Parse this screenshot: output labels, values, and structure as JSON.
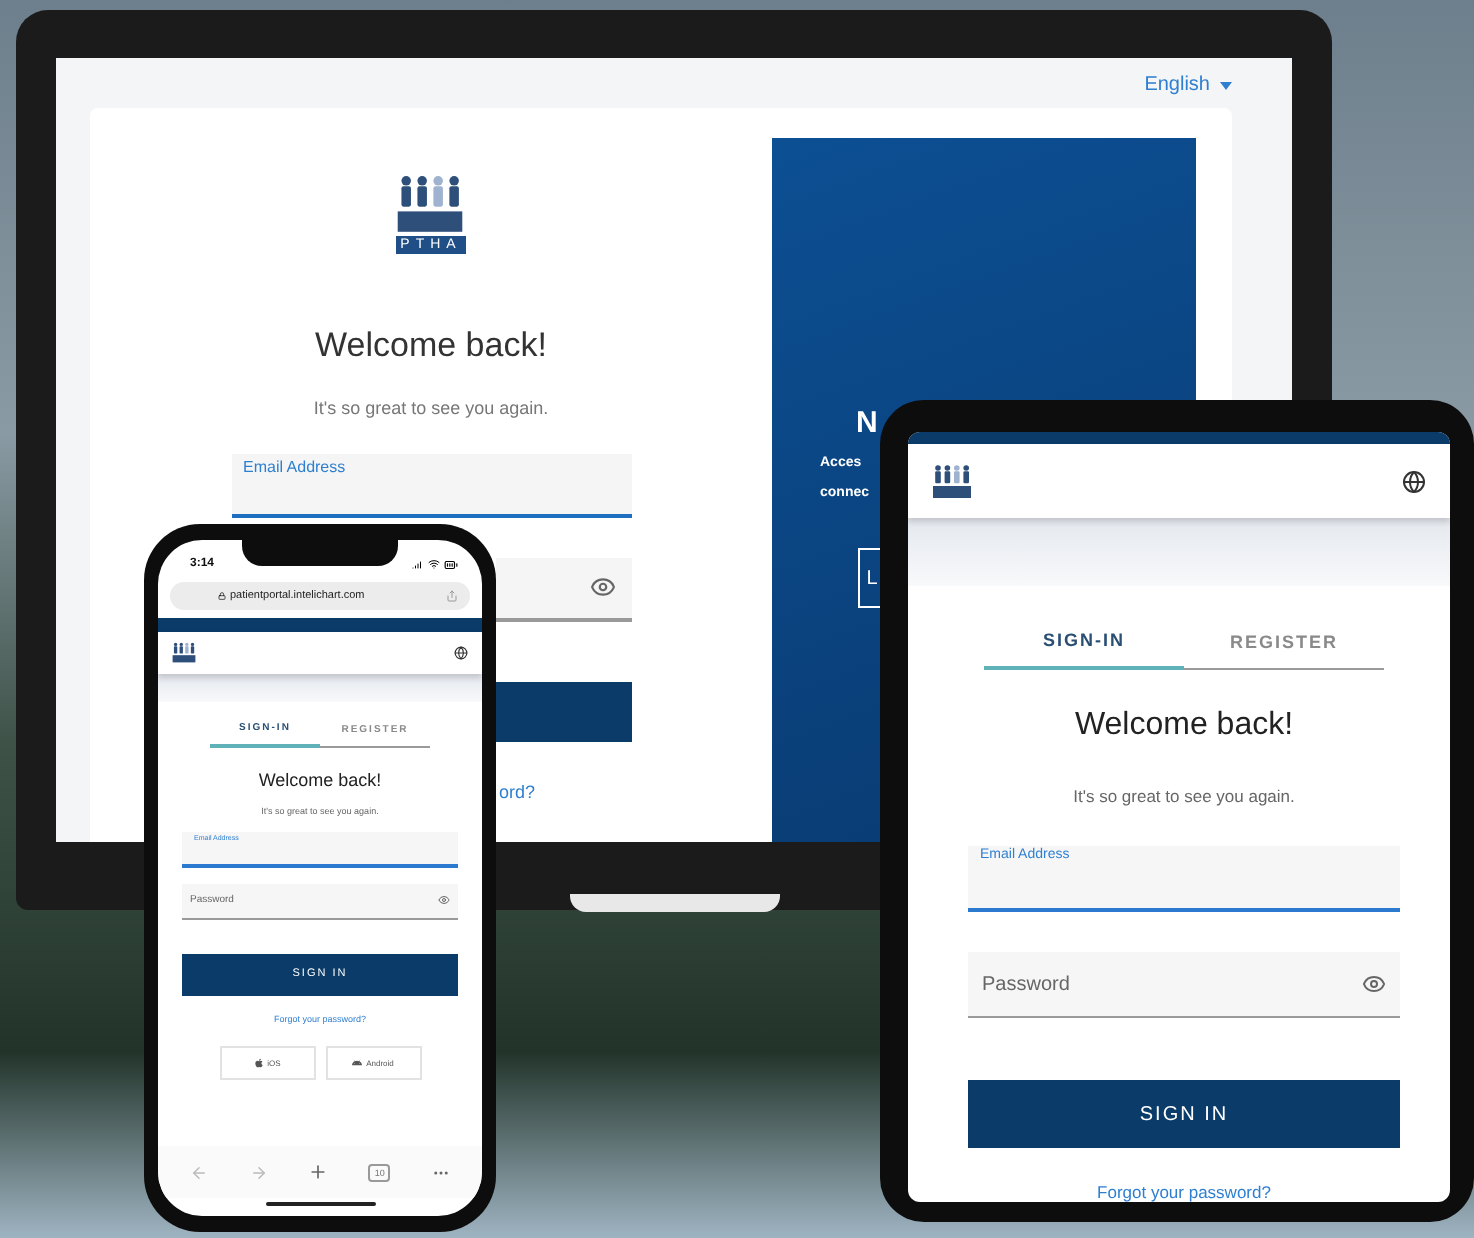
{
  "laptop": {
    "language": "English",
    "logo_text": "PTHA",
    "welcome": "Welcome back!",
    "subtitle": "It's so great to see you again.",
    "email_label": "Email Address",
    "forgot_fragment": "ord?",
    "promo": {
      "title_fragment": "N",
      "lines": [
        "Acces",
        "connec"
      ],
      "button_fragment": "L"
    }
  },
  "phone": {
    "time": "3:14",
    "url": "patientportal.intelichart.com",
    "tabs": [
      {
        "label": "SIGN-IN",
        "selected": true
      },
      {
        "label": "REGISTER",
        "selected": false
      }
    ],
    "welcome": "Welcome back!",
    "subtitle": "It's so great to see you again.",
    "email_label": "Email Address",
    "password_placeholder": "Password",
    "sign_in": "SIGN IN",
    "forgot": "Forgot your password?",
    "store_buttons": [
      {
        "kind": "ios",
        "label": "iOS"
      },
      {
        "kind": "android",
        "label": "Android"
      }
    ],
    "tab_count": "10"
  },
  "tablet": {
    "tabs": [
      {
        "label": "SIGN-IN",
        "selected": true
      },
      {
        "label": "REGISTER",
        "selected": false
      }
    ],
    "welcome": "Welcome back!",
    "subtitle": "It's so great to see you again.",
    "email_label": "Email Address",
    "password_placeholder": "Password",
    "sign_in": "SIGN IN",
    "forgot": "Forgot your password?"
  }
}
